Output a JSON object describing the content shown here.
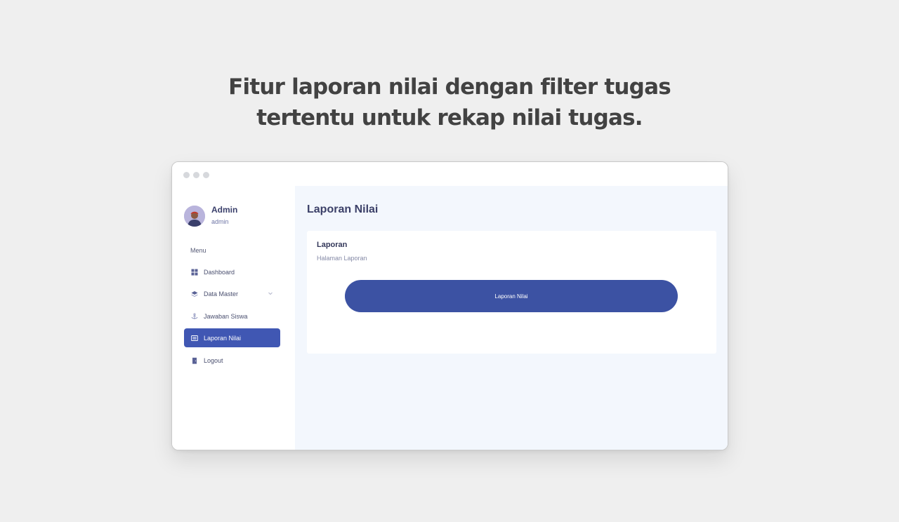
{
  "headline": {
    "line1": "Fitur laporan nilai dengan filter tugas",
    "line2": "tertentu untuk rekap nilai tugas."
  },
  "user": {
    "name": "Admin",
    "role": "admin"
  },
  "sidebar": {
    "menu_heading": "Menu",
    "items": [
      {
        "label": "Dashboard",
        "icon": "grid-icon"
      },
      {
        "label": "Data Master",
        "icon": "layers-icon"
      },
      {
        "label": "Jawaban Siswa",
        "icon": "anchor-icon"
      },
      {
        "label": "Laporan Nilai",
        "icon": "list-icon"
      },
      {
        "label": "Logout",
        "icon": "door-icon"
      }
    ]
  },
  "main": {
    "page_title": "Laporan Nilai",
    "card": {
      "title": "Laporan",
      "subtitle": "Halaman Laporan",
      "button_label": "Laporan Nilai"
    }
  },
  "colors": {
    "accent": "#4057b3",
    "button": "#3c52a3",
    "background": "#efefef",
    "main_bg": "#f3f7fd"
  }
}
